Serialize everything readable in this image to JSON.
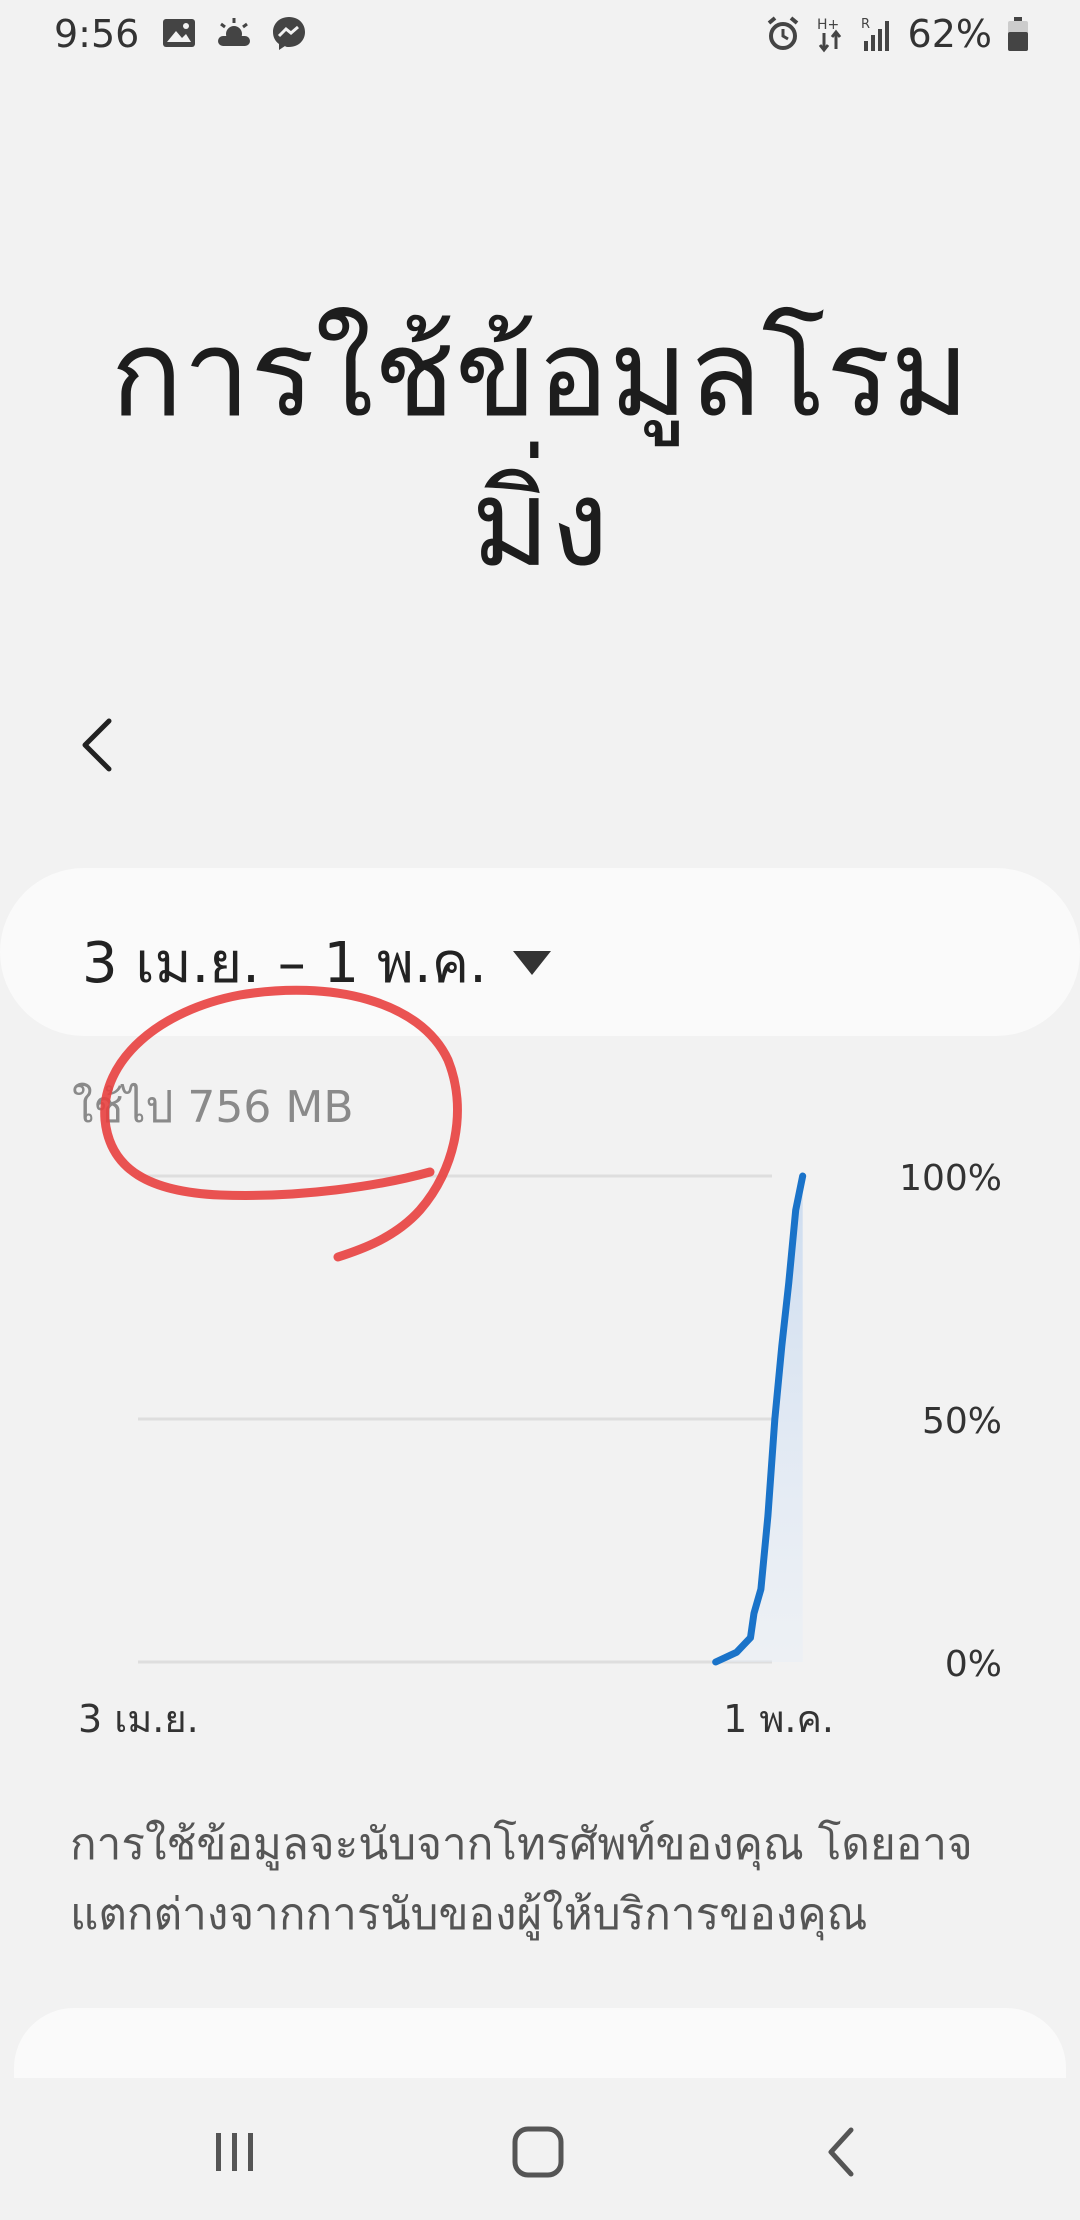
{
  "status_bar": {
    "time": "9:56",
    "left_icons": [
      "gallery-icon",
      "weather-icon",
      "messenger-icon"
    ],
    "right_icons": [
      "alarm-icon",
      "hplus-data-icon",
      "signal-icon"
    ],
    "battery": "62%"
  },
  "page": {
    "title_line1": "การใช้ข้อมูลโรม",
    "title_line2": "มิ่ง"
  },
  "date_selector": {
    "range": "3 เม.ย. – 1 พ.ค."
  },
  "usage": {
    "label": "ใช้ไป 756 MB"
  },
  "chart_data": {
    "type": "line",
    "x_start_label": "3 เม.ย.",
    "x_end_label": "1 พ.ค.",
    "y_tick_labels": [
      "100%",
      "50%",
      "0%"
    ],
    "ylim": [
      0,
      100
    ],
    "grid": true,
    "series": [
      {
        "color": "#1a73c9",
        "points": [
          [
            0.83,
            0
          ],
          [
            0.86,
            2
          ],
          [
            0.88,
            5
          ],
          [
            0.885,
            10
          ],
          [
            0.895,
            15
          ],
          [
            0.905,
            30
          ],
          [
            0.915,
            50
          ],
          [
            0.925,
            65
          ],
          [
            0.935,
            78
          ],
          [
            0.945,
            93
          ],
          [
            0.955,
            100
          ]
        ]
      }
    ]
  },
  "description": "การใช้ข้อมูลจะนับจากโทรศัพท์ของคุณ โดยอาจแตกต่างจากการนับของผู้ให้บริการของคุณ",
  "nav": {
    "icons": [
      "recent-apps-icon",
      "home-icon",
      "back-icon"
    ]
  },
  "colors": {
    "background": "#f2f2f2",
    "card": "#fafafa",
    "line": "#1a73c9",
    "annotation": "#e8403f"
  }
}
